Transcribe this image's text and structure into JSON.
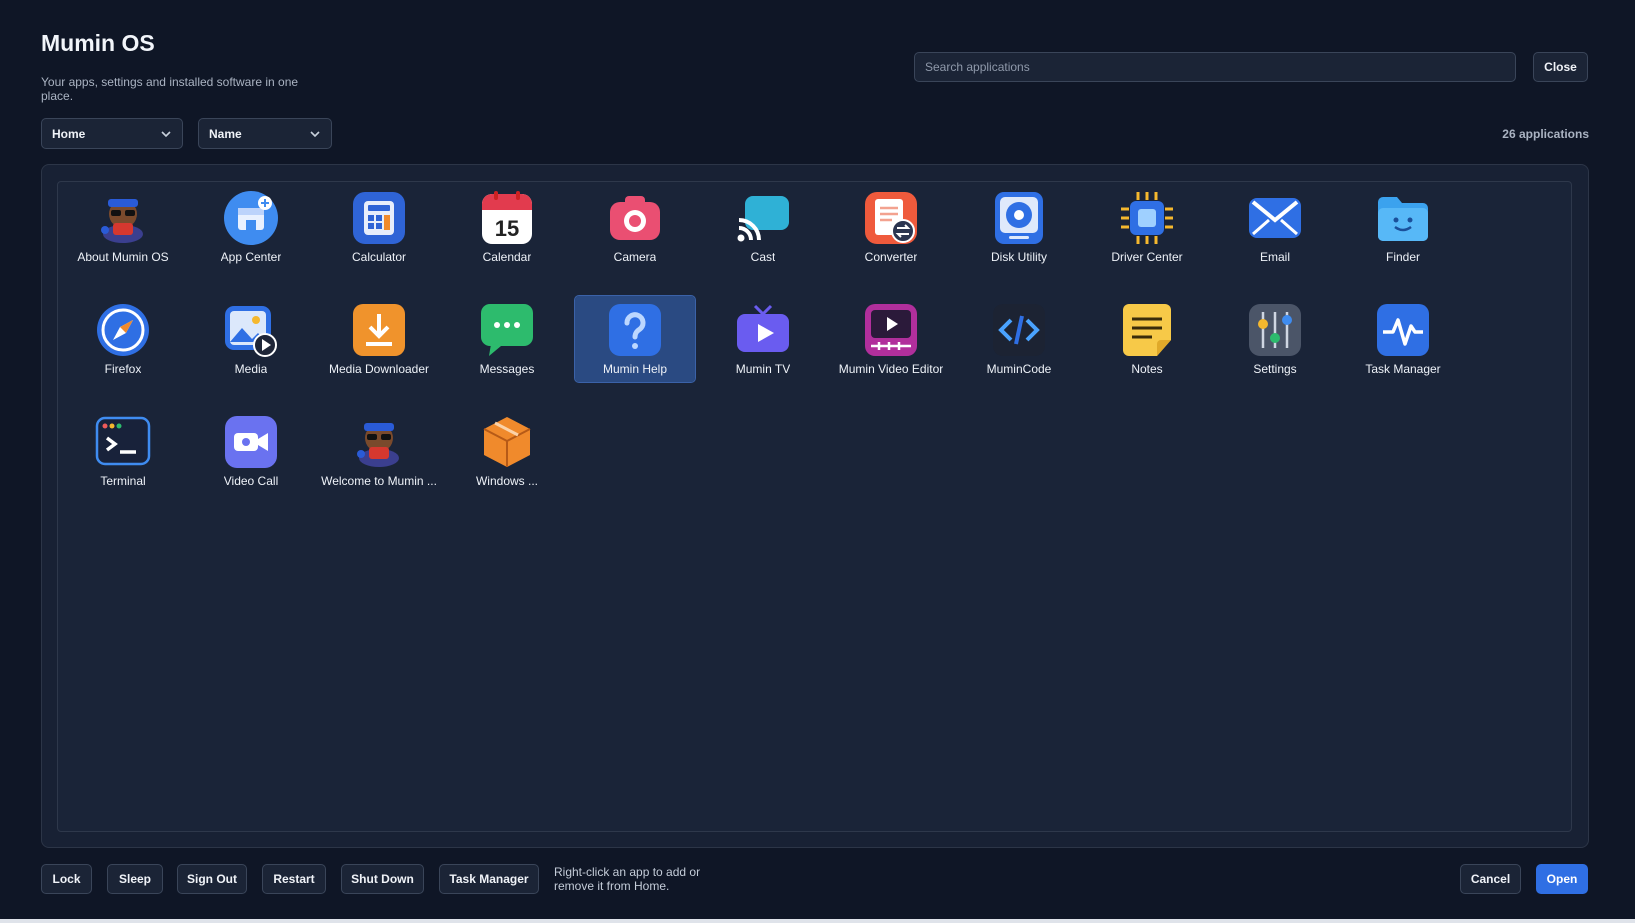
{
  "header": {
    "title": "Mumin OS",
    "subtitle": "Your apps, settings and installed software in one place."
  },
  "search": {
    "placeholder": "Search applications",
    "value": ""
  },
  "close_label": "Close",
  "filters": {
    "category": "Home",
    "sort": "Name"
  },
  "app_count": "26 applications",
  "selected_app": "Mumin Help",
  "apps": [
    {
      "label": "About Mumin OS",
      "icon": "mascot-icon"
    },
    {
      "label": "App Center",
      "icon": "store-icon"
    },
    {
      "label": "Calculator",
      "icon": "calculator-icon"
    },
    {
      "label": "Calendar",
      "icon": "calendar-icon",
      "icon_text": "15"
    },
    {
      "label": "Camera",
      "icon": "camera-icon"
    },
    {
      "label": "Cast",
      "icon": "cast-icon"
    },
    {
      "label": "Converter",
      "icon": "converter-icon"
    },
    {
      "label": "Disk Utility",
      "icon": "disk-icon"
    },
    {
      "label": "Driver Center",
      "icon": "chip-icon"
    },
    {
      "label": "Email",
      "icon": "mail-icon"
    },
    {
      "label": "Finder",
      "icon": "folder-icon"
    },
    {
      "label": "Firefox",
      "icon": "compass-icon"
    },
    {
      "label": "Media",
      "icon": "media-icon"
    },
    {
      "label": "Media Downloader",
      "icon": "download-icon"
    },
    {
      "label": "Messages",
      "icon": "chat-icon"
    },
    {
      "label": "Mumin Help",
      "icon": "help-icon"
    },
    {
      "label": "Mumin TV",
      "icon": "tv-icon"
    },
    {
      "label": "Mumin Video Editor",
      "icon": "video-editor-icon"
    },
    {
      "label": "MuminCode",
      "icon": "code-icon"
    },
    {
      "label": "Notes",
      "icon": "notes-icon"
    },
    {
      "label": "Settings",
      "icon": "sliders-icon"
    },
    {
      "label": "Task Manager",
      "icon": "pulse-icon"
    },
    {
      "label": "Terminal",
      "icon": "terminal-icon"
    },
    {
      "label": "Video Call",
      "icon": "video-call-icon"
    },
    {
      "label": "Welcome to Mumin ...",
      "icon": "mascot-icon"
    },
    {
      "label": "Windows ...",
      "icon": "box-icon"
    }
  ],
  "footer": {
    "buttons": [
      "Lock",
      "Sleep",
      "Sign Out",
      "Restart",
      "Shut Down",
      "Task Manager"
    ],
    "hint": "Right-click an app to add or remove it from Home.",
    "cancel_label": "Cancel",
    "open_label": "Open"
  },
  "colors": {
    "background": "#0f1626",
    "accent": "#2f6fe4",
    "selection": "#2a4a82"
  }
}
